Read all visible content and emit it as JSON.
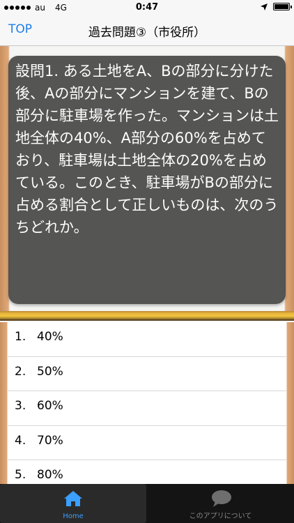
{
  "status": {
    "carrier": "au",
    "network": "4G",
    "time": "0:47"
  },
  "nav": {
    "back_label": "TOP",
    "title": "過去問題③（市役所）"
  },
  "question": {
    "text": "設問1. ある土地をA、Bの部分に分けた後、Aの部分にマンションを建て、Bの部分に駐車場を作った。マンションは土地全体の40%、A部分の60%を占めており、駐車場は土地全体の20%を占めている。このとき、駐車場がBの部分に占める割合として正しいものは、次のうちどれか。"
  },
  "answers": [
    {
      "num": "1.",
      "label": "40%"
    },
    {
      "num": "2.",
      "label": "50%"
    },
    {
      "num": "3.",
      "label": "60%"
    },
    {
      "num": "4.",
      "label": "70%"
    },
    {
      "num": "5.",
      "label": "80%"
    }
  ],
  "tabs": {
    "home": "Home",
    "about": "このアプリについて"
  },
  "colors": {
    "accent": "#1e7ee6",
    "tab_active": "#3ba0ff"
  }
}
